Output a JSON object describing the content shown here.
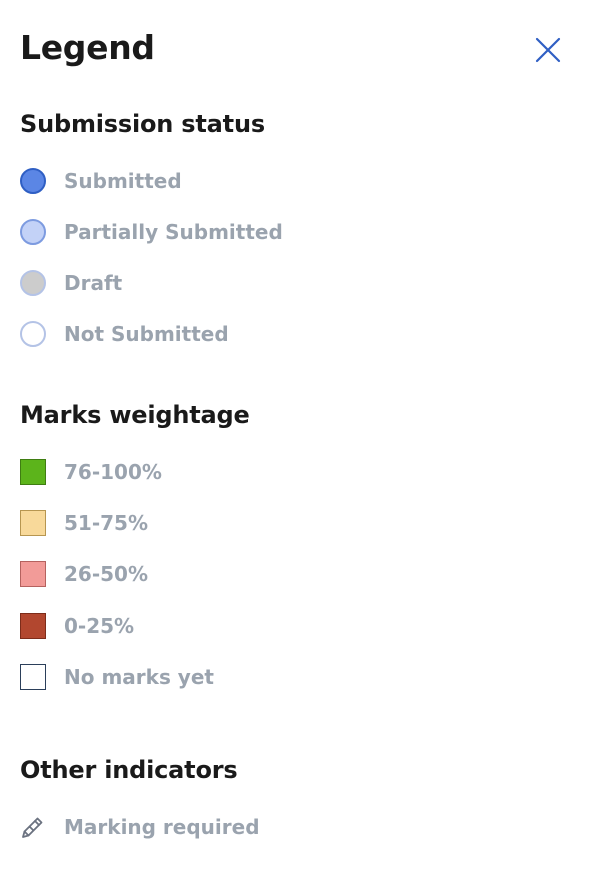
{
  "header": {
    "title": "Legend",
    "close_icon": "close-icon"
  },
  "submission_status": {
    "title": "Submission status",
    "items": [
      {
        "label": "Submitted",
        "fill": "#5b86e5",
        "border": "#2f5fc4"
      },
      {
        "label": "Partially Submitted",
        "fill": "#c3d2f7",
        "border": "#7d9be0"
      },
      {
        "label": "Draft",
        "fill": "#cccccc",
        "border": "#b4c3e6"
      },
      {
        "label": "Not Submitted",
        "fill": "#ffffff",
        "border": "#b4c3e6"
      }
    ]
  },
  "marks_weightage": {
    "title": "Marks weightage",
    "items": [
      {
        "label": "76-100%",
        "fill": "#5cb41b",
        "border": "#3f7d12"
      },
      {
        "label": "51-75%",
        "fill": "#f8d99a",
        "border": "#b79650"
      },
      {
        "label": "26-50%",
        "fill": "#f29b98",
        "border": "#b5625f"
      },
      {
        "label": "0-25%",
        "fill": "#b2472f",
        "border": "#7d2c1a"
      },
      {
        "label": "No marks yet",
        "fill": "#ffffff",
        "border": "#2b3f5a"
      }
    ]
  },
  "other_indicators": {
    "title": "Other indicators",
    "items": [
      {
        "label": "Marking required",
        "icon": "pencil-icon"
      }
    ]
  }
}
